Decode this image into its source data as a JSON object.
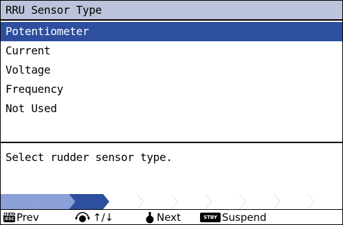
{
  "title": "RRU Sensor Type",
  "options": [
    {
      "label": "Potentiometer",
      "selected": true
    },
    {
      "label": "Current",
      "selected": false
    },
    {
      "label": "Voltage",
      "selected": false
    },
    {
      "label": "Frequency",
      "selected": false
    },
    {
      "label": "Not Used",
      "selected": false
    }
  ],
  "description": "Select rudder sensor type.",
  "progress": {
    "total_steps": 10,
    "completed_steps": 2,
    "current_step": 3
  },
  "hints": {
    "menu_key_top": "MENU",
    "menu_key_bottom": "/ESC",
    "prev": "Prev",
    "updown": "↑/↓",
    "next": "Next",
    "stby_key": "STBY",
    "suspend": "Suspend"
  },
  "colors": {
    "title_bg": "#bcc3dc",
    "selected_bg": "#2e4f9f",
    "progress_done": "#8aa0d6",
    "progress_current": "#2e4f9f",
    "progress_outline": "#cccccc"
  }
}
